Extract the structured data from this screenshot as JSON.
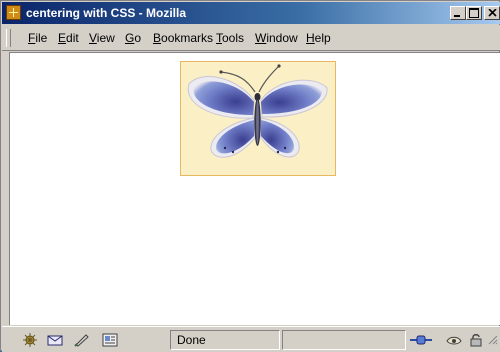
{
  "window": {
    "title": "centering with CSS - Mozilla"
  },
  "menu": {
    "items": [
      "File",
      "Edit",
      "View",
      "Go",
      "Bookmarks",
      "Tools",
      "Window",
      "Help"
    ]
  },
  "content": {
    "image_subject": "blue butterfly",
    "image_background_color": "#fbefc6",
    "image_border_color": "#e8b860"
  },
  "status": {
    "text": "Done"
  },
  "icons": {
    "status_left": [
      "navigator-icon",
      "mail-icon",
      "composer-icon",
      "address-book-icon"
    ],
    "status_right": [
      "online-status-icon",
      "cookie-icon",
      "security-lock-icon"
    ]
  },
  "colors": {
    "titlebar_start": "#0a246a",
    "titlebar_end": "#a6caf0",
    "chrome": "#d4d0c8"
  }
}
